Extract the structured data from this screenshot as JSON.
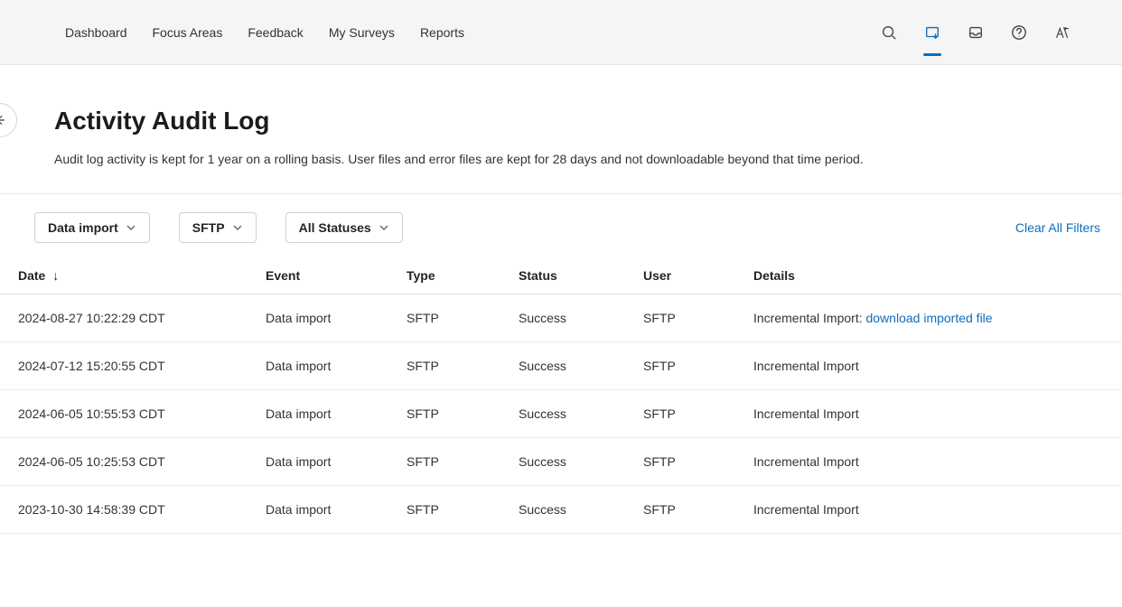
{
  "nav": {
    "links": [
      "Dashboard",
      "Focus Areas",
      "Feedback",
      "My Surveys",
      "Reports"
    ]
  },
  "page": {
    "title": "Activity Audit Log",
    "subtitle": "Audit log activity is kept for 1 year on a rolling basis. User files and error files are kept for 28 days and not downloadable beyond that time period."
  },
  "filters": {
    "event": "Data import",
    "type": "SFTP",
    "status": "All Statuses",
    "clear": "Clear All Filters"
  },
  "table": {
    "headers": {
      "date": "Date",
      "event": "Event",
      "type": "Type",
      "status": "Status",
      "user": "User",
      "details": "Details"
    },
    "rows": [
      {
        "date": "2024-08-27 10:22:29 CDT",
        "event": "Data import",
        "type": "SFTP",
        "status": "Success",
        "user": "SFTP",
        "details_prefix": "Incremental Import: ",
        "download": "download imported file"
      },
      {
        "date": "2024-07-12 15:20:55 CDT",
        "event": "Data import",
        "type": "SFTP",
        "status": "Success",
        "user": "SFTP",
        "details": "Incremental Import"
      },
      {
        "date": "2024-06-05 10:55:53 CDT",
        "event": "Data import",
        "type": "SFTP",
        "status": "Success",
        "user": "SFTP",
        "details": "Incremental Import"
      },
      {
        "date": "2024-06-05 10:25:53 CDT",
        "event": "Data import",
        "type": "SFTP",
        "status": "Success",
        "user": "SFTP",
        "details": "Incremental Import"
      },
      {
        "date": "2023-10-30 14:58:39 CDT",
        "event": "Data import",
        "type": "SFTP",
        "status": "Success",
        "user": "SFTP",
        "details": "Incremental Import"
      }
    ]
  }
}
